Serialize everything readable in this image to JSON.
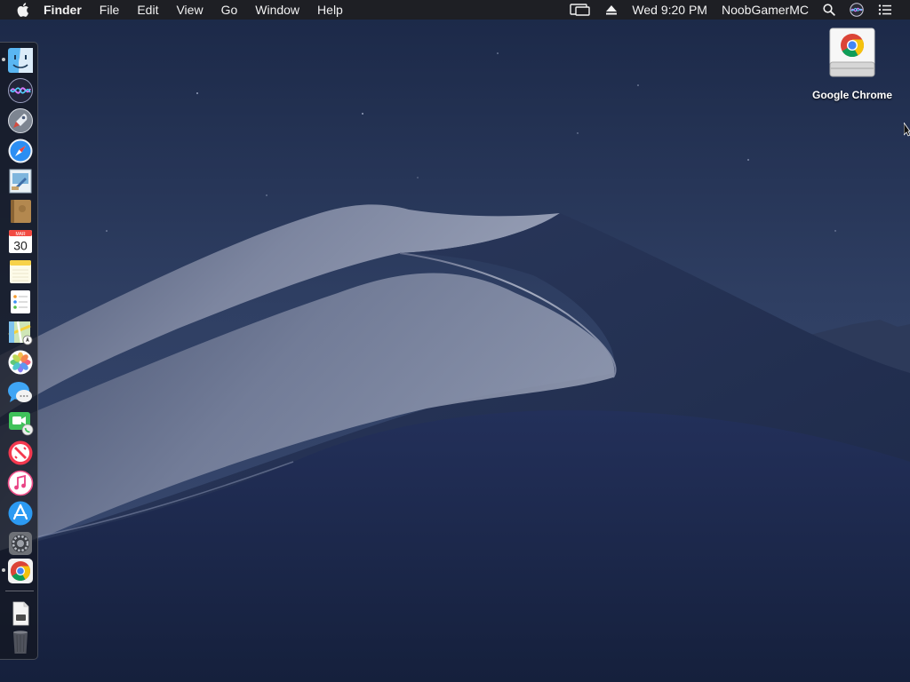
{
  "menubar": {
    "apple_icon": "apple-logo-icon",
    "app_name": "Finder",
    "menus": [
      "File",
      "Edit",
      "View",
      "Go",
      "Window",
      "Help"
    ],
    "status": {
      "display_icon": "airplay-display-icon",
      "eject_icon": "eject-icon",
      "clock": "Wed 9:20 PM",
      "user": "NoobGamerMC",
      "search_icon": "spotlight-search-icon",
      "siri_icon": "siri-icon",
      "notification_icon": "notification-center-icon"
    }
  },
  "dock": {
    "apps": [
      {
        "name": "Finder",
        "icon": "finder-icon",
        "running": true
      },
      {
        "name": "Siri",
        "icon": "siri-icon",
        "running": false
      },
      {
        "name": "Launchpad",
        "icon": "launchpad-icon",
        "running": false
      },
      {
        "name": "Safari",
        "icon": "safari-icon",
        "running": false
      },
      {
        "name": "Mail",
        "icon": "mail-icon",
        "running": false
      },
      {
        "name": "Contacts",
        "icon": "contacts-icon",
        "running": false
      },
      {
        "name": "Calendar",
        "icon": "calendar-icon",
        "running": false,
        "month": "MAR",
        "day": "30"
      },
      {
        "name": "Notes",
        "icon": "notes-icon",
        "running": false
      },
      {
        "name": "Reminders",
        "icon": "reminders-icon",
        "running": false
      },
      {
        "name": "Maps",
        "icon": "maps-icon",
        "running": false
      },
      {
        "name": "Photos",
        "icon": "photos-icon",
        "running": false
      },
      {
        "name": "Messages",
        "icon": "messages-icon",
        "running": false
      },
      {
        "name": "FaceTime",
        "icon": "facetime-icon",
        "running": false
      },
      {
        "name": "News",
        "icon": "news-icon",
        "running": false
      },
      {
        "name": "iTunes",
        "icon": "itunes-icon",
        "running": false
      },
      {
        "name": "App Store",
        "icon": "app-store-icon",
        "running": false
      },
      {
        "name": "System Preferences",
        "icon": "system-preferences-icon",
        "running": false
      },
      {
        "name": "Google Chrome",
        "icon": "chrome-icon",
        "running": true
      }
    ],
    "others": [
      {
        "name": "Document",
        "icon": "document-icon"
      },
      {
        "name": "Trash",
        "icon": "trash-icon"
      }
    ]
  },
  "desktop": {
    "icons": [
      {
        "label": "Google Chrome",
        "icon": "chrome-disk-image-icon"
      }
    ],
    "wallpaper": "mojave-night-dunes"
  },
  "colors": {
    "menubar_bg": "#1e1e22",
    "sky_top": "#1b2a4a",
    "sky_bottom": "#33456e",
    "dune_light": "#8b93ab",
    "dune_dark": "#1c2847"
  }
}
